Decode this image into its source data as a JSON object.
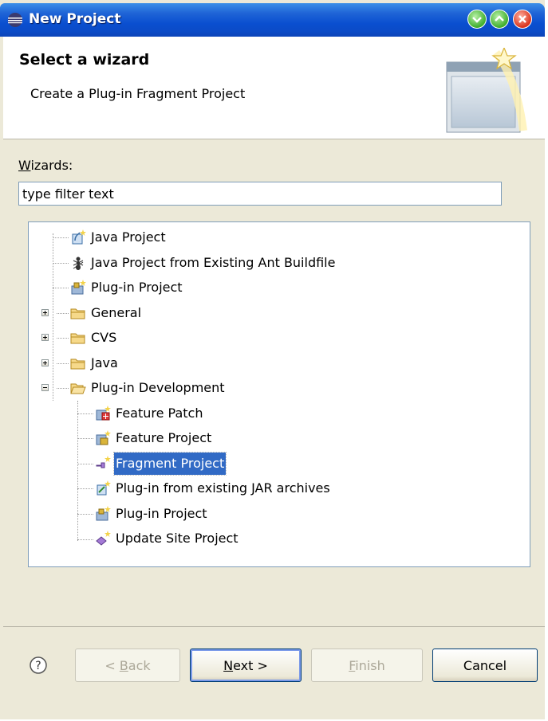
{
  "window": {
    "title": "New Project"
  },
  "header": {
    "title": "Select a wizard",
    "description": "Create a Plug-in Fragment Project"
  },
  "filter": {
    "label_prefix": "W",
    "label_rest": "izards:",
    "value": "type filter text"
  },
  "tree": {
    "items": [
      {
        "label": "Java Project",
        "icon": "java-project-icon"
      },
      {
        "label": "Java Project from Existing Ant Buildfile",
        "icon": "ant-icon"
      },
      {
        "label": "Plug-in Project",
        "icon": "plugin-project-icon"
      },
      {
        "label": "General",
        "icon": "folder-icon",
        "expander": "+"
      },
      {
        "label": "CVS",
        "icon": "folder-icon",
        "expander": "+"
      },
      {
        "label": "Java",
        "icon": "folder-icon",
        "expander": "+"
      },
      {
        "label": "Plug-in Development",
        "icon": "folder-open-icon",
        "expander": "-"
      },
      {
        "label": "Feature Patch",
        "icon": "feature-patch-icon"
      },
      {
        "label": "Feature Project",
        "icon": "feature-project-icon"
      },
      {
        "label": "Fragment Project",
        "icon": "fragment-project-icon",
        "selected": true
      },
      {
        "label": "Plug-in from existing JAR archives",
        "icon": "jar-plugin-icon"
      },
      {
        "label": "Plug-in Project",
        "icon": "plugin-project-icon"
      },
      {
        "label": "Update Site Project",
        "icon": "update-site-icon"
      }
    ]
  },
  "buttons": {
    "back_prefix": "< ",
    "back_mnemonic": "B",
    "back_rest": "ack",
    "next_mnemonic": "N",
    "next_rest": "ext >",
    "finish_mnemonic": "F",
    "finish_rest": "inish",
    "cancel": "Cancel"
  },
  "colors": {
    "title_bar": "#0a4fd0",
    "selection": "#316ac5",
    "dialog_bg": "#ece9d8"
  }
}
